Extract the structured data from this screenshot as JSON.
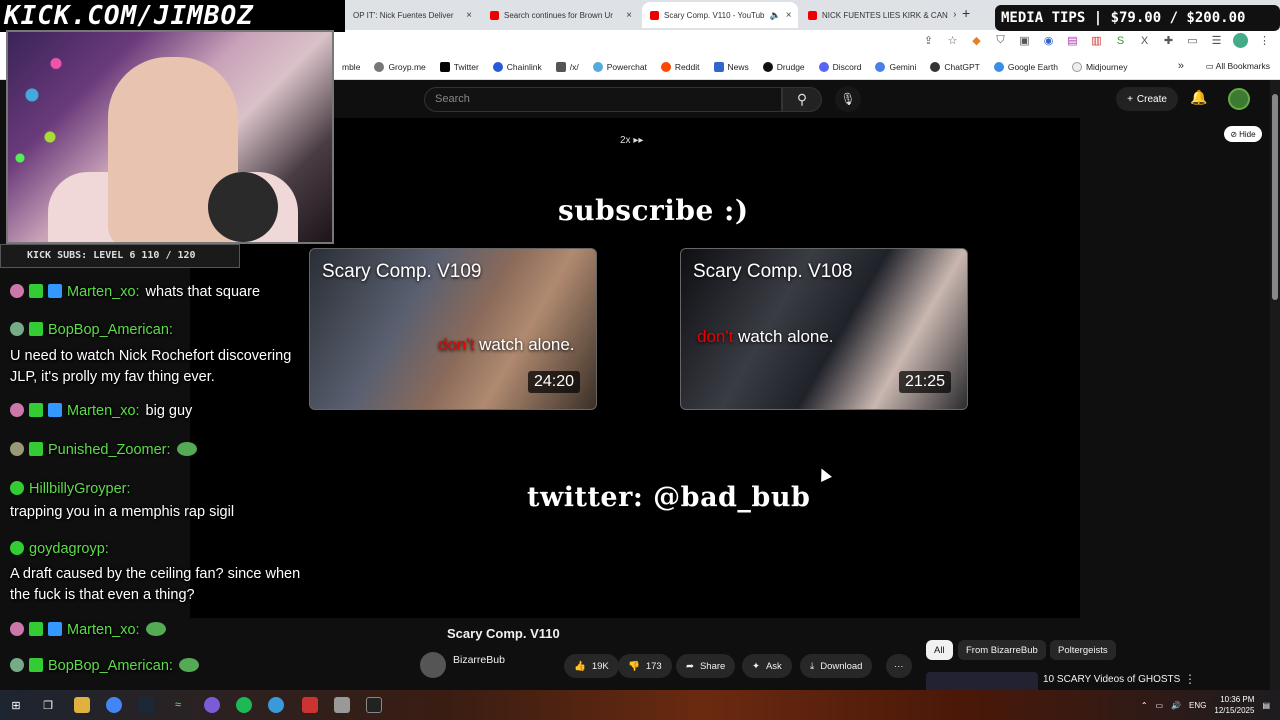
{
  "browser": {
    "tabs": [
      {
        "label": "OP IT': Nick Fuentes Deliver",
        "active": false
      },
      {
        "label": "Search continues for Brown Ur",
        "active": false
      },
      {
        "label": "Scary Comp. V110 - YouTub",
        "active": true
      },
      {
        "label": "NICK FUENTES LIES KIRK & CAN",
        "active": false
      }
    ],
    "new_tab": "+",
    "bookmarks": [
      "mble",
      "Groyp.me",
      "Twitter",
      "Chainlink",
      "/x/",
      "Powerchat",
      "Reddit",
      "News",
      "Drudge",
      "Discord",
      "Gemini",
      "ChatGPT",
      "Google Earth",
      "Midjourney"
    ],
    "bookmarks_more": "»",
    "all_bookmarks": "All Bookmarks"
  },
  "overlay": {
    "title": "KICK.COM/JIMBOZ",
    "media_tips": "MEDIA TIPS | $79.00 / $200.00",
    "kick_subs": "KICK SUBS: LEVEL 6 110 / 120"
  },
  "youtube": {
    "search_placeholder": "Search",
    "create_label": "Create",
    "hide_label": "Hide",
    "speed_label": "2x ▸▸",
    "end_screen": {
      "subscribe": "subscribe :)",
      "twitter": "twitter: @bad_bub",
      "cards": [
        {
          "title": "Scary Comp. V109",
          "tag_red": "don't",
          "tag_white": "watch alone.",
          "duration": "24:20"
        },
        {
          "title": "Scary Comp. V108",
          "tag_red": "don't",
          "tag_white": "watch alone.",
          "duration": "21:25"
        }
      ]
    },
    "video_title": "Scary Comp. V110",
    "channel": "BizarreBub",
    "actions": {
      "likes": "19K",
      "dislikes": "173",
      "share": "Share",
      "ask": "Ask",
      "download": "Download"
    },
    "chips": [
      "All",
      "From BizarreBub",
      "Poltergeists"
    ],
    "recommendation": "10 SCARY Videos of GHOSTS"
  },
  "chat": [
    {
      "user": "Marten_xo:",
      "text": "whats that square"
    },
    {
      "user": "BopBop_American:",
      "text": "U need to watch Nick Rochefort discovering JLP, it's prolly my fav thing ever."
    },
    {
      "user": "Marten_xo:",
      "text": "big guy"
    },
    {
      "user": "Punished_Zoomer:",
      "text": ""
    },
    {
      "user": "HillbillyGroyper:",
      "text": "trapping you in a memphis rap sigil"
    },
    {
      "user": "goydagroyp:",
      "text": "A draft caused by the ceiling fan? since when the fuck is that even a thing?"
    },
    {
      "user": "Marten_xo:",
      "text": ""
    },
    {
      "user": "BopBop_American:",
      "text": ""
    }
  ],
  "taskbar": {
    "lang": "ENG",
    "time": "10:36 PM",
    "date": "12/15/2025"
  },
  "colors": {
    "chat_user": "#5ddc4a",
    "youtube_red": "#e00000"
  }
}
